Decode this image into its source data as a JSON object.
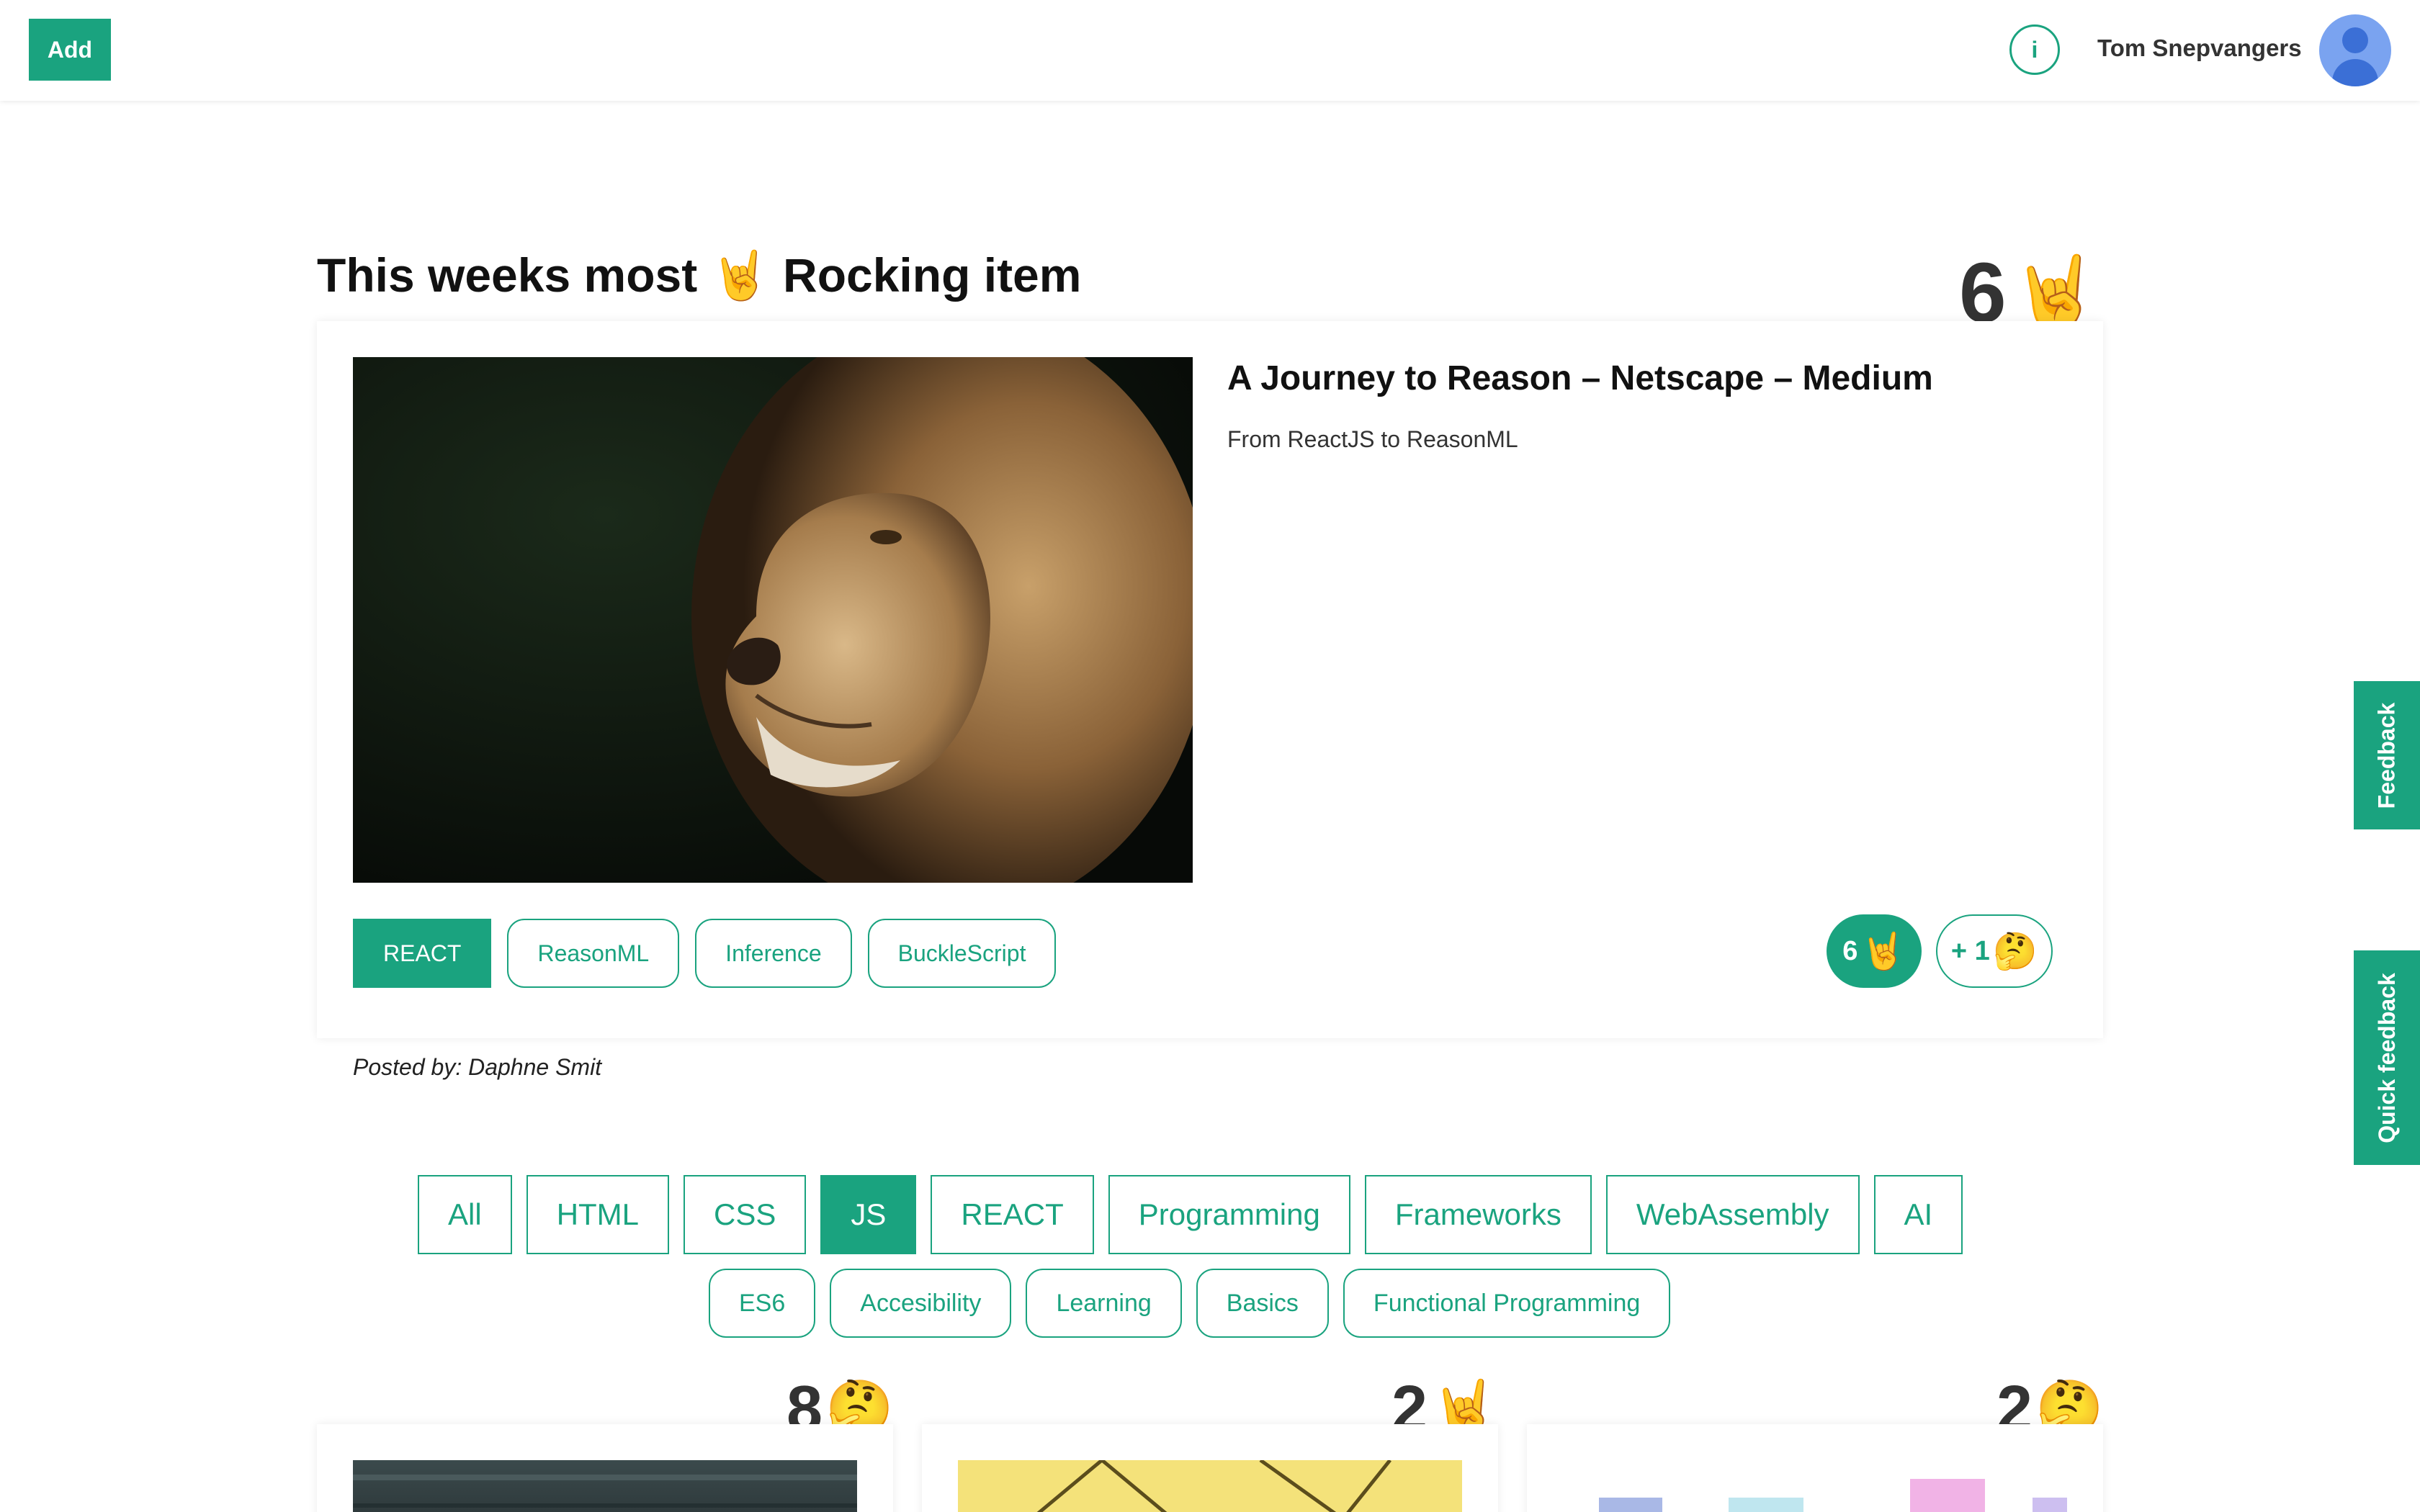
{
  "header": {
    "add_label": "Add",
    "info_label": "i",
    "user_name": "Tom Snepvangers"
  },
  "side_tabs": {
    "feedback": "Feedback",
    "quick_feedback": "Quick feedback"
  },
  "featured": {
    "title": "This weeks most 🤘 Rocking item",
    "count": "6",
    "count_emoji": "🤘",
    "item_title": "A Journey to Reason – Netscape – Medium",
    "item_description": "From ReactJS to ReasonML",
    "tags": [
      {
        "label": "REACT",
        "active": true
      },
      {
        "label": "ReasonML",
        "active": false
      },
      {
        "label": "Inference",
        "active": false
      },
      {
        "label": "BuckleScript",
        "active": false
      }
    ],
    "votes": {
      "rock_count": "6",
      "rock_emoji": "🤘",
      "think_label": "+ 1",
      "think_emoji": "🤔"
    },
    "posted_by": "Posted by: Daphne Smit"
  },
  "categories": {
    "primary": [
      {
        "label": "All",
        "active": false
      },
      {
        "label": "HTML",
        "active": false
      },
      {
        "label": "CSS",
        "active": false
      },
      {
        "label": "JS",
        "active": true
      },
      {
        "label": "REACT",
        "active": false
      },
      {
        "label": "Programming",
        "active": false
      },
      {
        "label": "Frameworks",
        "active": false
      },
      {
        "label": "WebAssembly",
        "active": false
      },
      {
        "label": "AI",
        "active": false
      }
    ],
    "secondary": [
      "ES6",
      "Accesibility",
      "Learning",
      "Basics",
      "Functional Programming"
    ]
  },
  "cards": [
    {
      "count": "8",
      "emoji": "🤔"
    },
    {
      "count": "2",
      "emoji": "🤘"
    },
    {
      "count": "2",
      "emoji": "🤔"
    }
  ],
  "colors": {
    "accent": "#1aa37f",
    "text_dark": "#111111"
  }
}
